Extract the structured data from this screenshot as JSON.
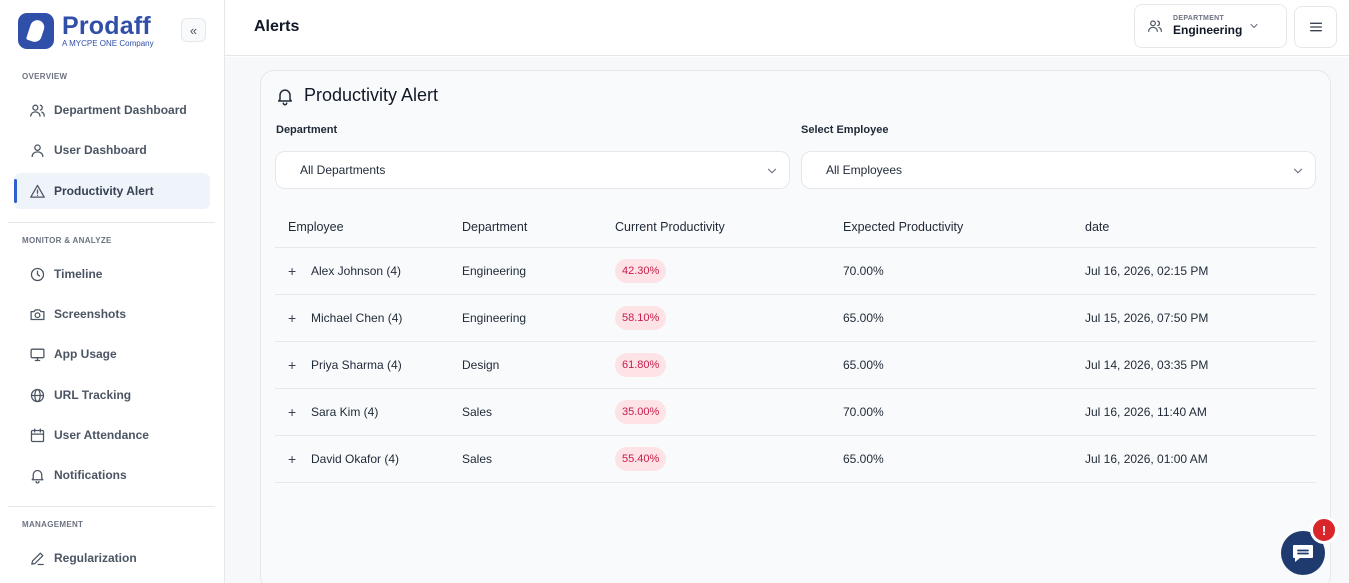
{
  "brand": {
    "name": "Prodaff",
    "tagline": "A MYCPE ONE Company"
  },
  "sidebar": {
    "sections": [
      {
        "label": "OVERVIEW"
      },
      {
        "label": "MONITOR & ANALYZE"
      },
      {
        "label": "MANAGEMENT"
      }
    ],
    "items": [
      {
        "label": "Department Dashboard",
        "icon": "users-icon"
      },
      {
        "label": "User Dashboard",
        "icon": "user-icon"
      },
      {
        "label": "Productivity Alert",
        "icon": "warning-icon",
        "active": true
      },
      {
        "label": "Timeline",
        "icon": "clock-icon"
      },
      {
        "label": "Screenshots",
        "icon": "camera-icon"
      },
      {
        "label": "App Usage",
        "icon": "monitor-icon"
      },
      {
        "label": "URL Tracking",
        "icon": "globe-icon"
      },
      {
        "label": "User Attendance",
        "icon": "calendar-icon"
      },
      {
        "label": "Notifications",
        "icon": "bell-icon"
      },
      {
        "label": "Regularization",
        "icon": "pen-icon"
      }
    ]
  },
  "header": {
    "title": "Alerts",
    "department_label": "DEPARTMENT",
    "department_value": "Engineering"
  },
  "card": {
    "title": "Productivity Alert",
    "department_field": {
      "label": "Department",
      "value": "All Departments"
    },
    "employee_field": {
      "label": "Select Employee",
      "value": "All Employees"
    }
  },
  "table": {
    "columns": [
      "Employee",
      "Department",
      "Current Productivity",
      "Expected Productivity",
      "date"
    ],
    "rows": [
      {
        "employee": "Alex Johnson (4)",
        "department": "Engineering",
        "current": "42.30%",
        "expected": "70.00%",
        "date": "Jul 16, 2026, 02:15 PM"
      },
      {
        "employee": "Michael Chen (4)",
        "department": "Engineering",
        "current": "58.10%",
        "expected": "65.00%",
        "date": "Jul 15, 2026, 07:50 PM"
      },
      {
        "employee": "Priya Sharma (4)",
        "department": "Design",
        "current": "61.80%",
        "expected": "65.00%",
        "date": "Jul 14, 2026, 03:35 PM"
      },
      {
        "employee": "Sara Kim (4)",
        "department": "Sales",
        "current": "35.00%",
        "expected": "70.00%",
        "date": "Jul 16, 2026, 11:40 AM"
      },
      {
        "employee": "David Okafor (4)",
        "department": "Sales",
        "current": "55.40%",
        "expected": "65.00%",
        "date": "Jul 16, 2026, 01:00 AM"
      }
    ]
  },
  "chat": {
    "alert_glyph": "!"
  },
  "colors": {
    "brand": "#2f4fa8",
    "accent": "#2f5fd0",
    "badge_bg": "#fde2e6",
    "badge_text": "#c81e4a",
    "chat": "#1e3a6e",
    "alert": "#d9262b"
  }
}
